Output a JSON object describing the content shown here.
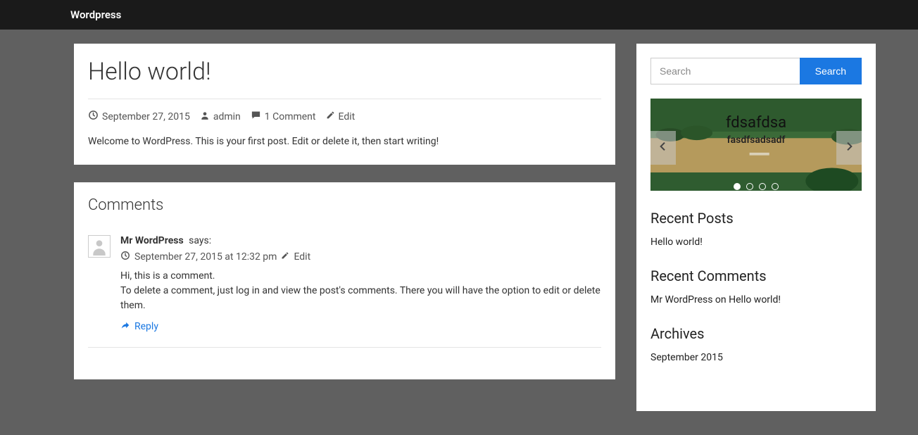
{
  "topbar": {
    "title": "Wordpress"
  },
  "post": {
    "title": "Hello world!",
    "date": "September 27, 2015",
    "author": "admin",
    "comments_label": "1 Comment",
    "edit_label": "Edit",
    "body": "Welcome to WordPress. This is your first post. Edit or delete it, then start writing!"
  },
  "comments": {
    "heading": "Comments",
    "items": [
      {
        "author": "Mr WordPress",
        "says": "says:",
        "meta_time": "September 27, 2015 at 12:32 pm",
        "edit": "Edit",
        "line1": "Hi, this is a comment.",
        "line2": "To delete a comment, just log in and view the post's comments. There you will have the option to edit or delete them.",
        "reply": "Reply"
      }
    ]
  },
  "sidebar": {
    "search_placeholder": "Search",
    "search_button": "Search",
    "slider": {
      "title": "fdsafdsa",
      "subtitle": "fasdfsadsadf",
      "dot_count": 4,
      "active_dot": 0
    },
    "recent_posts": {
      "title": "Recent Posts",
      "items": [
        "Hello world!"
      ]
    },
    "recent_comments": {
      "title": "Recent Comments",
      "items": [
        "Mr WordPress on Hello world!"
      ]
    },
    "archives": {
      "title": "Archives",
      "items": [
        "September 2015"
      ]
    }
  }
}
